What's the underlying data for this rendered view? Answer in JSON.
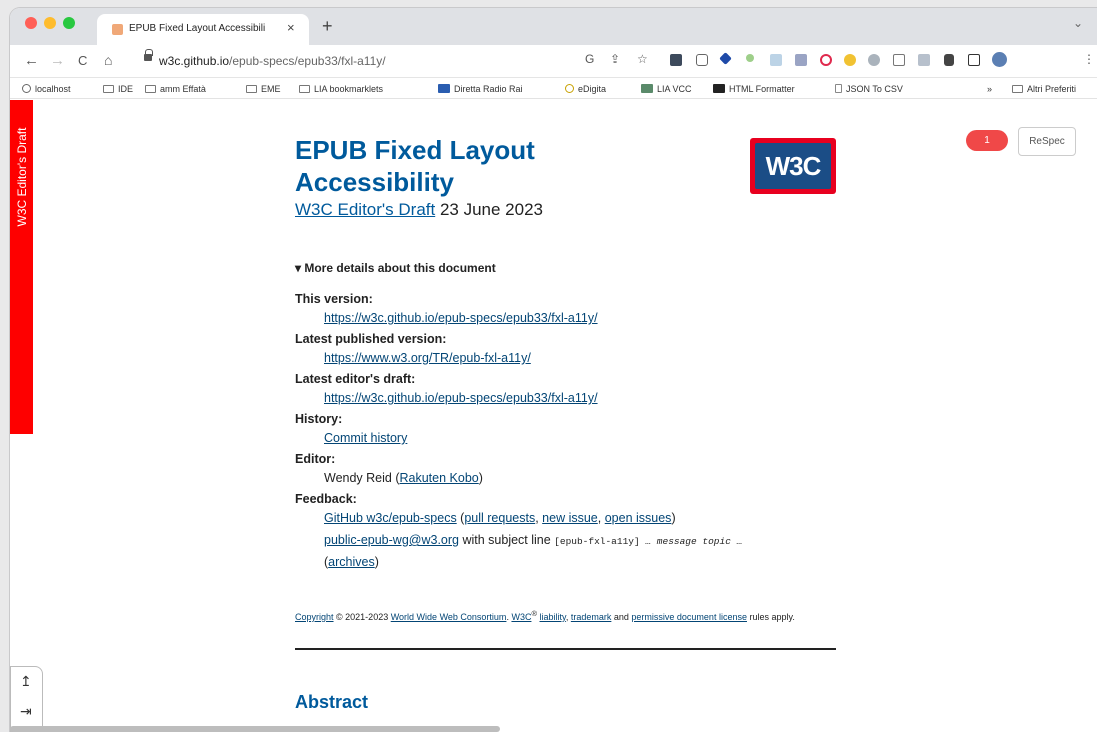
{
  "browser": {
    "tab_title": "EPUB Fixed Layout Accessibili",
    "tab_close": "×",
    "new_tab": "+",
    "tab_menu": "⌄",
    "url_host": "w3c.github.io",
    "url_path": "/epub-specs/epub33/fxl-a11y/",
    "nav": {
      "back": "←",
      "forward": "→",
      "reload": "C",
      "home": "⌂"
    },
    "extensions": {
      "google": "G",
      "share": "⇪",
      "star": "☆",
      "more": "⋮"
    }
  },
  "bookmarks": {
    "items": [
      {
        "label": "localhost"
      },
      {
        "label": "IDE"
      },
      {
        "label": "amm Effatà"
      },
      {
        "label": "EME"
      },
      {
        "label": "LIA bookmarklets"
      },
      {
        "label": "Diretta Radio Rai"
      },
      {
        "label": "eDigita"
      },
      {
        "label": "LIA VCC"
      },
      {
        "label": "HTML Formatter"
      },
      {
        "label": "JSON To CSV"
      }
    ],
    "overflow": "»",
    "other": "Altri Preferiti"
  },
  "page": {
    "banner": "W3C Editor's Draft",
    "title_line1": "EPUB Fixed Layout",
    "title_line2": "Accessibility",
    "status_link": "W3C Editor's Draft",
    "date": "23 June 2023",
    "logo": "W3C",
    "respec_badge": "1",
    "respec_button": "ReSpec",
    "details_toggle": "▾ More details about this document",
    "details": {
      "this_version_label": "This version:",
      "this_version": "https://w3c.github.io/epub-specs/epub33/fxl-a11y/",
      "latest_published_label": "Latest published version:",
      "latest_published": "https://www.w3.org/TR/epub-fxl-a11y/",
      "latest_editors_label": "Latest editor's draft:",
      "latest_editors": "https://w3c.github.io/epub-specs/epub33/fxl-a11y/",
      "history_label": "History:",
      "history": "Commit history",
      "editor_label": "Editor:",
      "editor_name": "Wendy Reid (",
      "editor_org": "Rakuten Kobo",
      "editor_close": ")",
      "feedback_label": "Feedback:",
      "github_link": "GitHub w3c/epub-specs",
      "fb_open": " (",
      "pull_requests": "pull requests",
      "comma1": ", ",
      "new_issue": "new issue",
      "comma2": ", ",
      "open_issues": "open issues",
      "fb_close": ")",
      "mail_link": "public-epub-wg@w3.org",
      "subject_text": " with subject line ",
      "subject_code": "[epub-fxl-a11y]",
      "message_topic": " … message topic …",
      "archives": "archives"
    },
    "copyright": {
      "copyright_link": "Copyright",
      "years": " © 2021-2023 ",
      "consortium": "World Wide Web Consortium",
      "w3c": "W3C",
      "reg": "®",
      "liability": "liability",
      "trademark": "trademark",
      "and": " and ",
      "permissive": "permissive document license",
      "rules": " rules apply."
    },
    "abstract": "Abstract",
    "side_tools": {
      "top": "↥",
      "bottom": "⇥"
    }
  }
}
